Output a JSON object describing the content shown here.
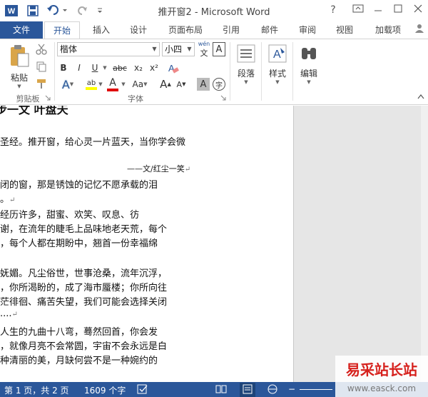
{
  "window": {
    "title": "推开窗2 - Microsoft Word",
    "help": "?"
  },
  "tabs": [
    "文件",
    "开始",
    "插入",
    "设计",
    "页面布局",
    "引用",
    "邮件",
    "审阅",
    "视图",
    "加载项"
  ],
  "ribbon": {
    "clipboard": {
      "paste_label": "粘贴",
      "group_label": "剪贴板"
    },
    "font": {
      "font_name": "楷体",
      "font_size": "小四",
      "phonetic": "wén",
      "bold": "B",
      "italic": "I",
      "underline": "U",
      "strike": "abc",
      "subscript": "x₂",
      "superscript": "x²",
      "text_effect": "A",
      "highlight": "ab",
      "font_color": "A",
      "change_case": "Aa",
      "grow": "A",
      "shrink": "A",
      "shading": "A",
      "enclose": "字",
      "char_border": "A",
      "group_label": "字体"
    },
    "paragraph_label": "段落",
    "styles_label": "样式",
    "editing_label": "编辑"
  },
  "document": {
    "lines": [
      "步一文 叶盘天",
      "圣经。推开窗，给心灵一片蓝天，当你学会微",
      "——文/红尘一笑",
      "闭的窗，那是锈蚀的记忆不愿承载的泪",
      "。",
      "经历许多，甜蜜、欢笑、叹息、彷",
      "谢，在流年的睫毛上品味地老天荒，每个",
      "，每个人都在期盼中，翘首一份幸福绵",
      "妩媚。凡尘俗世，世事沧桑，流年沉浮，",
      "，你所渴盼的，成了海市蜃楼；你所向往",
      "茫徘徊、痛苦失望，我们可能会选择关闭",
      "....",
      "人生的九曲十八弯，蓦然回首，你会发",
      "，就像月亮不会常圆，宇宙不会永远是白",
      "种清丽的美，月缺何尝不是一种婉约的"
    ]
  },
  "status": {
    "page": "第 1 页，共 2 页",
    "words": "1609 个字"
  },
  "watermark": {
    "title": "易采站长站",
    "url": "www.easck.com"
  },
  "colors": {
    "accent": "#2b579a",
    "font_color_red": "#e00000",
    "highlight_yellow": "#ffff00"
  }
}
